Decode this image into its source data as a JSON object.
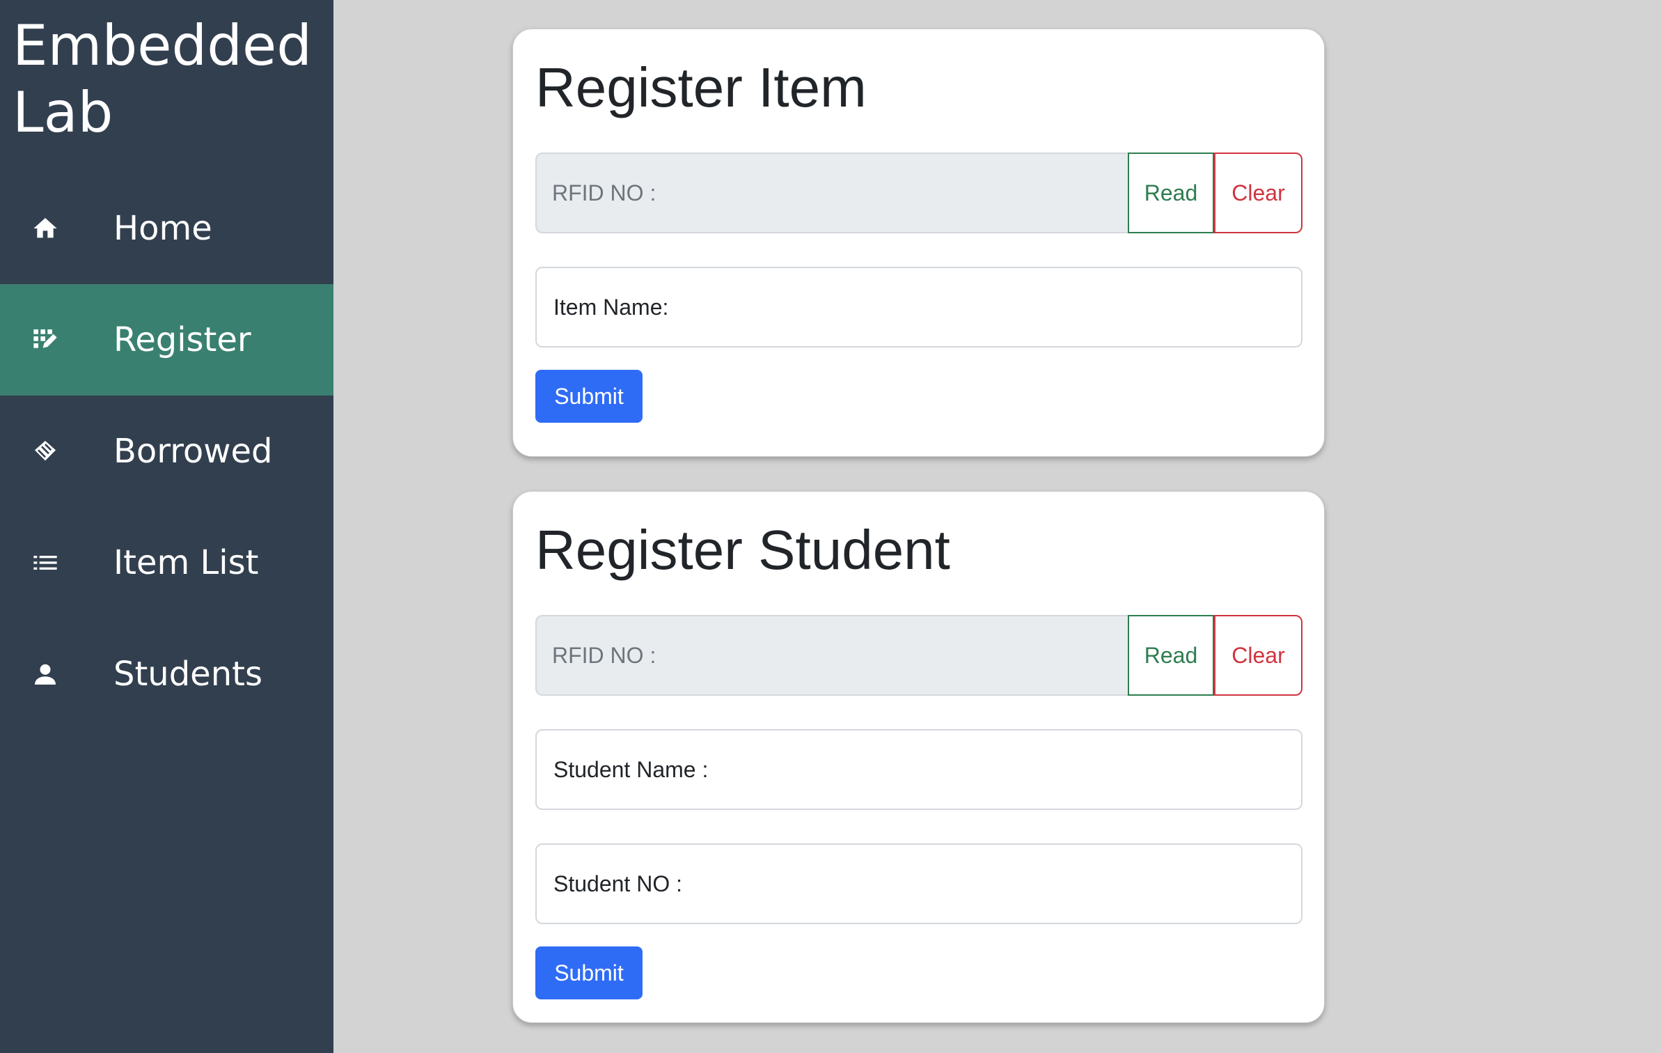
{
  "sidebar": {
    "brand": "Embedded Lab",
    "items": [
      {
        "label": "Home",
        "icon": "home-icon"
      },
      {
        "label": "Register",
        "icon": "register-icon",
        "active": true
      },
      {
        "label": "Borrowed",
        "icon": "handshake-icon"
      },
      {
        "label": "Item List",
        "icon": "list-icon"
      },
      {
        "label": "Students",
        "icon": "person-icon"
      }
    ]
  },
  "register_item": {
    "title": "Register Item",
    "rfid_placeholder": "RFID NO :",
    "read_label": "Read",
    "clear_label": "Clear",
    "item_name_placeholder": "Item Name:",
    "submit_label": "Submit"
  },
  "register_student": {
    "title": "Register Student",
    "rfid_placeholder": "RFID NO :",
    "read_label": "Read",
    "clear_label": "Clear",
    "student_name_placeholder": "Student Name :",
    "student_no_placeholder": "Student NO :",
    "submit_label": "Submit"
  },
  "colors": {
    "sidebar_bg": "#323f4f",
    "active_item_bg": "#3a8070",
    "page_bg": "#d3d3d3",
    "primary": "#2f6cf6",
    "success": "#2e7d4f",
    "danger": "#d0343f"
  }
}
